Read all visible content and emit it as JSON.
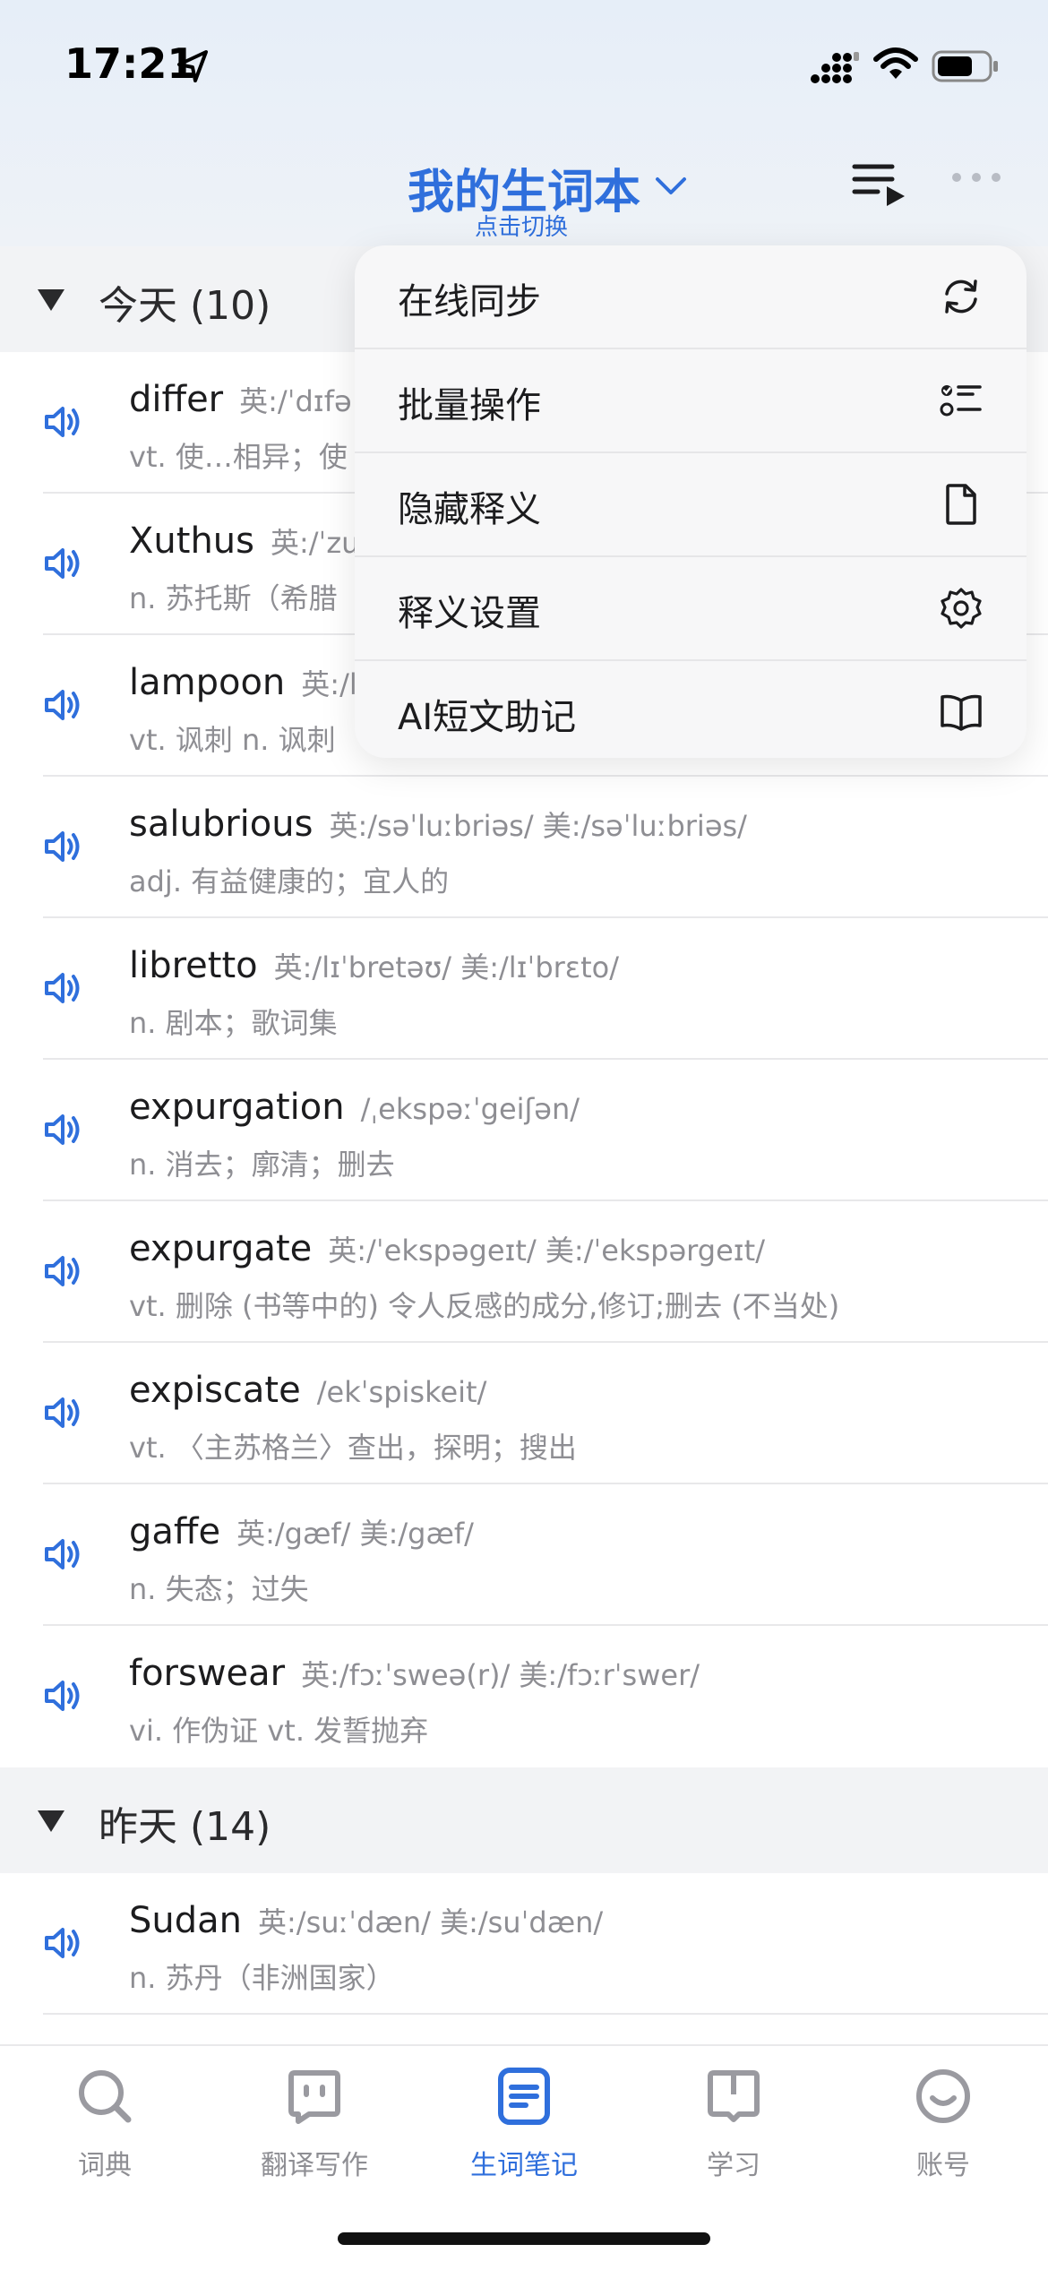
{
  "status_bar": {
    "time": "17:21"
  },
  "nav": {
    "title": "我的生词本",
    "subtitle": "点击切换"
  },
  "groups": [
    {
      "label": "今天 (10)"
    },
    {
      "label": "昨天 (14)"
    }
  ],
  "today_words": [
    {
      "word": "differ",
      "phonetic": "英:/ˈdɪfə",
      "definition": "vt. 使…相异；使"
    },
    {
      "word": "Xuthus",
      "phonetic": "英:/ˈzu",
      "definition": "n. 苏托斯（希腊"
    },
    {
      "word": "lampoon",
      "phonetic": "英:/l",
      "definition": "vt. 讽刺 n. 讽刺"
    },
    {
      "word": "salubrious",
      "phonetic": "英:/səˈluːbriəs/   美:/səˈluːbriəs/",
      "definition": "adj. 有益健康的；宜人的"
    },
    {
      "word": "libretto",
      "phonetic": "英:/lɪˈbretəʊ/   美:/lɪˈbrɛto/",
      "definition": "n. 剧本；歌词集"
    },
    {
      "word": "expurgation",
      "phonetic": "/ˌekspəːˈgeiʃən/",
      "definition": "n. 消去；廓清；删去"
    },
    {
      "word": "expurgate",
      "phonetic": "英:/ˈekspəgeɪt/   美:/ˈekspərgeɪt/",
      "definition": "vt. 删除 (书等中的) 令人反感的成分,修订;删去 (不当处)"
    },
    {
      "word": "expiscate",
      "phonetic": "/ekˈspiskeit/",
      "definition": "vt. 〈主苏格兰〉查出，探明；搜出"
    },
    {
      "word": "gaffe",
      "phonetic": "英:/gæf/   美:/gæf/",
      "definition": "n. 失态；过失"
    },
    {
      "word": "forswear",
      "phonetic": "英:/fɔːˈsweə(r)/   美:/fɔːrˈswer/",
      "definition": "vi. 作伪证 vt. 发誓抛弃"
    }
  ],
  "yesterday_words": [
    {
      "word": "Sudan",
      "phonetic": "英:/suːˈdæn/   美:/suˈdæn/",
      "definition": "n. 苏丹（非洲国家）"
    }
  ],
  "menu": [
    {
      "label": "在线同步",
      "icon": "sync-icon"
    },
    {
      "label": "批量操作",
      "icon": "checklist-icon"
    },
    {
      "label": "隐藏释义",
      "icon": "document-icon"
    },
    {
      "label": "释义设置",
      "icon": "gear-icon"
    },
    {
      "label": "AI短文助记",
      "icon": "book-icon"
    }
  ],
  "tabs": [
    {
      "label": "词典",
      "icon": "search-icon",
      "active": false
    },
    {
      "label": "翻译写作",
      "icon": "translate-icon",
      "active": false
    },
    {
      "label": "生词笔记",
      "icon": "notebook-icon",
      "active": true
    },
    {
      "label": "学习",
      "icon": "book-icon",
      "active": false
    },
    {
      "label": "账号",
      "icon": "smiley-icon",
      "active": false
    }
  ],
  "colors": {
    "accent": "#2f6fdc",
    "muted": "#8e8e93",
    "group_bg": "#f2f3f5"
  }
}
